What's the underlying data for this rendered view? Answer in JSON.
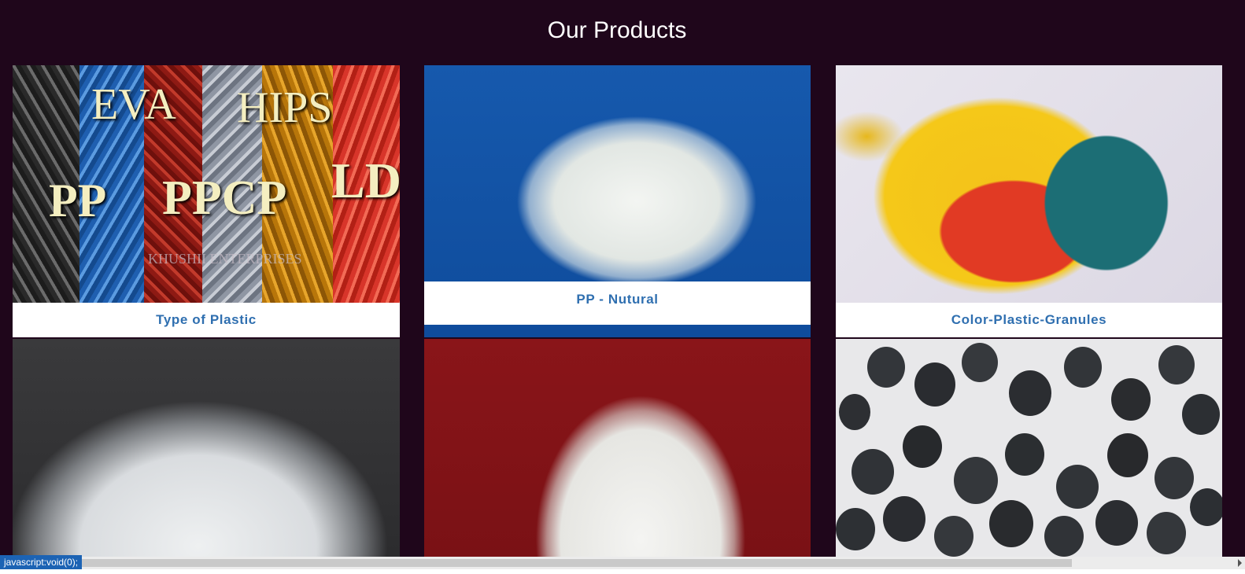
{
  "section": {
    "title": "Our Products"
  },
  "products": [
    {
      "caption": "Type of Plastic",
      "image": "plastic-types-image"
    },
    {
      "caption": "PP - Nutural",
      "image": "pp-natural-granules-image"
    },
    {
      "caption": "Color-Plastic-Granules",
      "image": "color-granules-image"
    },
    {
      "caption": "",
      "image": "clear-granules-image"
    },
    {
      "caption": "",
      "image": "white-granules-image"
    },
    {
      "caption": "",
      "image": "black-granules-image"
    }
  ],
  "stripe_labels": {
    "pp": "PP",
    "eva": "EVA",
    "ppcp": "PPCP",
    "hips": "HIPS",
    "ldpe": "LDPE",
    "watermark": "KHUSHII ENTERPRISES"
  },
  "status": {
    "link_text": "javascript:void(0);"
  },
  "colors": {
    "background": "#1f061b",
    "caption_text": "#2f6fb0",
    "status_bar": "#1c63b4"
  }
}
